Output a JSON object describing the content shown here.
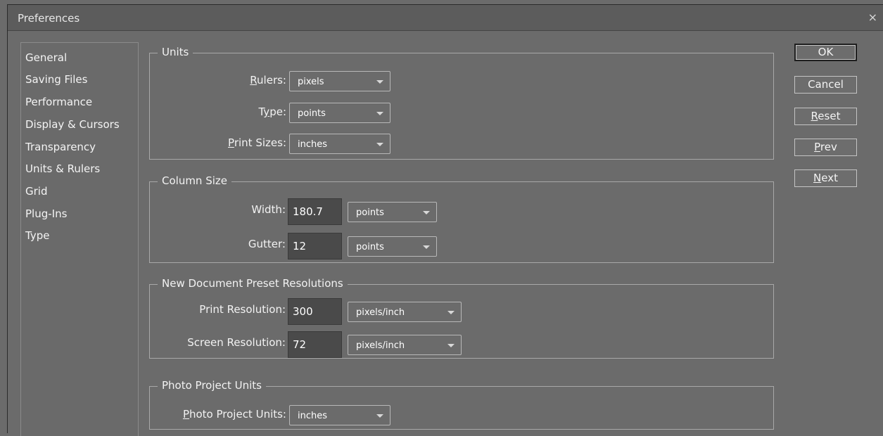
{
  "window": {
    "title": "Preferences",
    "close_glyph": "×"
  },
  "sidebar": {
    "items": [
      {
        "label": "General"
      },
      {
        "label": "Saving Files"
      },
      {
        "label": "Performance"
      },
      {
        "label": "Display & Cursors"
      },
      {
        "label": "Transparency"
      },
      {
        "label": "Units & Rulers"
      },
      {
        "label": "Grid"
      },
      {
        "label": "Plug-Ins"
      },
      {
        "label": "Type"
      }
    ]
  },
  "units": {
    "legend": "Units",
    "rulers": {
      "label_u": "R",
      "label_rest": "ulers:",
      "value": "pixels"
    },
    "type": {
      "label_pre": "T",
      "label_u": "y",
      "label_rest": "pe:",
      "value": "points"
    },
    "print_sizes": {
      "label_u": "P",
      "label_rest": "rint Sizes:",
      "value": "inches"
    }
  },
  "column_size": {
    "legend": "Column Size",
    "width": {
      "label": "Width:",
      "value": "180.7",
      "unit": "points"
    },
    "gutter": {
      "label": "Gutter:",
      "value": "12",
      "unit": "points"
    }
  },
  "new_document_preset": {
    "legend": "New Document Preset Resolutions",
    "print_resolution": {
      "label": "Print Resolution:",
      "value": "300",
      "unit": "pixels/inch"
    },
    "screen_resolution": {
      "label": "Screen Resolution:",
      "value": "72",
      "unit": "pixels/inch"
    }
  },
  "photo_project": {
    "legend": "Photo Project Units",
    "units": {
      "label_u": "P",
      "label_rest": "hoto Project Units:",
      "value": "inches"
    }
  },
  "buttons": {
    "ok": "OK",
    "cancel": "Cancel",
    "reset_u": "R",
    "reset_rest": "eset",
    "prev_u": "P",
    "prev_rest": "rev",
    "next_u": "N",
    "next_rest": "ext"
  },
  "colors": {
    "background": "#6b6b6b",
    "titlebar": "#5c5c5c",
    "field": "#4a4a4a"
  }
}
